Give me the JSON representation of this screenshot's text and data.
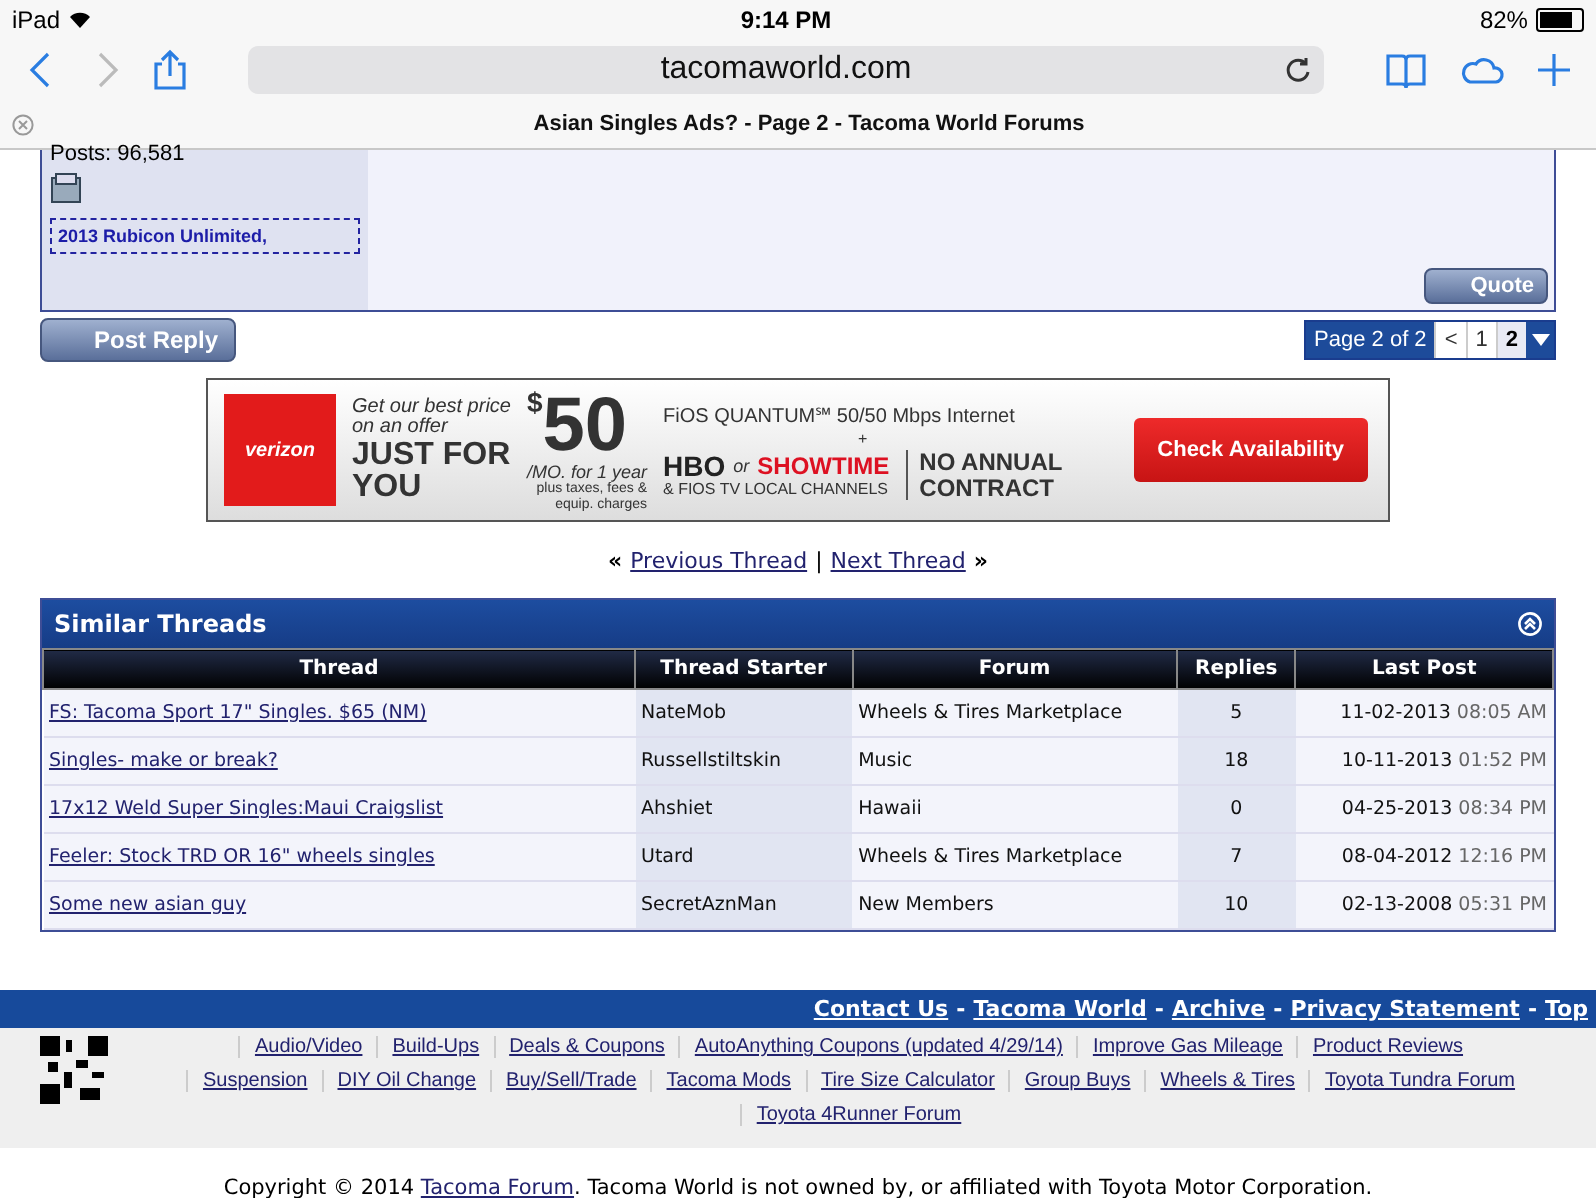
{
  "status_bar": {
    "device": "iPad",
    "time": "9:14 PM",
    "battery": "82%"
  },
  "browser": {
    "url": "tacomaworld.com",
    "tab_title": "Asian Singles Ads? - Page 2 - Tacoma World Forums"
  },
  "post": {
    "posts": "Posts: 96,581",
    "signature": "2013 Rubicon Unlimited,",
    "quote_button": "Quote"
  },
  "post_reply_button": "Post Reply",
  "pagination": {
    "label": "Page 2 of 2",
    "prev": "<",
    "pages": [
      {
        "label": "1",
        "selected": false
      },
      {
        "label": "2",
        "selected": true
      }
    ]
  },
  "ad": {
    "brand": "verizon",
    "lines": [
      "Get our best price",
      "on an offer"
    ],
    "headline": [
      "JUST FOR",
      "YOU"
    ],
    "price_symbol": "$",
    "price": "50",
    "price_note": "/MO. for 1 year",
    "fine_print": [
      "plus taxes, fees &",
      "equip. charges"
    ],
    "product": "FiOS QUANTUM℠ 50/50 Mbps Internet",
    "plus": "+",
    "channels": [
      "HBO",
      "or",
      "SHOWTIME"
    ],
    "channels_note": "& FIOS TV LOCAL CHANNELS",
    "contract": [
      "NO ANNUAL",
      "CONTRACT"
    ],
    "cta": "Check Availability"
  },
  "thread_nav": {
    "prev_mark": "«",
    "prev": "Previous Thread",
    "separator": "|",
    "next": "Next Thread",
    "next_mark": "»"
  },
  "similar_threads": {
    "title": "Similar Threads",
    "columns": [
      "Thread",
      "Thread Starter",
      "Forum",
      "Replies",
      "Last Post"
    ],
    "rows": [
      {
        "thread": "FS: Tacoma Sport 17\" Singles. $65 (NM)",
        "starter": "NateMob",
        "forum": "Wheels & Tires Marketplace",
        "replies": "5",
        "date": "11-02-2013",
        "time": "08:05 AM"
      },
      {
        "thread": "Singles- make or break?",
        "starter": "Russellstiltskin",
        "forum": "Music",
        "replies": "18",
        "date": "10-11-2013",
        "time": "01:52 PM"
      },
      {
        "thread": "17x12 Weld Super Singles:Maui Craigslist",
        "starter": "Ahshiet",
        "forum": "Hawaii",
        "replies": "0",
        "date": "04-25-2013",
        "time": "08:34 PM"
      },
      {
        "thread": "Feeler: Stock TRD OR 16\" wheels singles",
        "starter": "Utard",
        "forum": "Wheels & Tires Marketplace",
        "replies": "7",
        "date": "08-04-2012",
        "time": "12:16 PM"
      },
      {
        "thread": "Some new asian guy",
        "starter": "SecretAznMan",
        "forum": "New Members",
        "replies": "10",
        "date": "02-13-2008",
        "time": "05:31 PM"
      }
    ]
  },
  "footer_bar": {
    "links": [
      "Contact Us",
      "Tacoma World",
      "Archive",
      "Privacy Statement",
      "Top"
    ],
    "separator": "-"
  },
  "footer_links": [
    [
      "Audio/Video",
      "Build-Ups",
      "Deals & Coupons",
      "AutoAnything Coupons (updated 4/29/14)",
      "Improve Gas Mileage",
      "Product Reviews"
    ],
    [
      "Suspension",
      "DIY Oil Change",
      "Buy/Sell/Trade",
      "Tacoma Mods",
      "Tire Size Calculator",
      "Group Buys",
      "Wheels & Tires",
      "Toyota Tundra Forum"
    ],
    [
      "Toyota 4Runner Forum"
    ]
  ],
  "copyright": {
    "before": "Copyright © 2014",
    "link": "Tacoma Forum",
    "after": ". Tacoma World is not owned by, or affiliated with Toyota Motor Corporation."
  }
}
